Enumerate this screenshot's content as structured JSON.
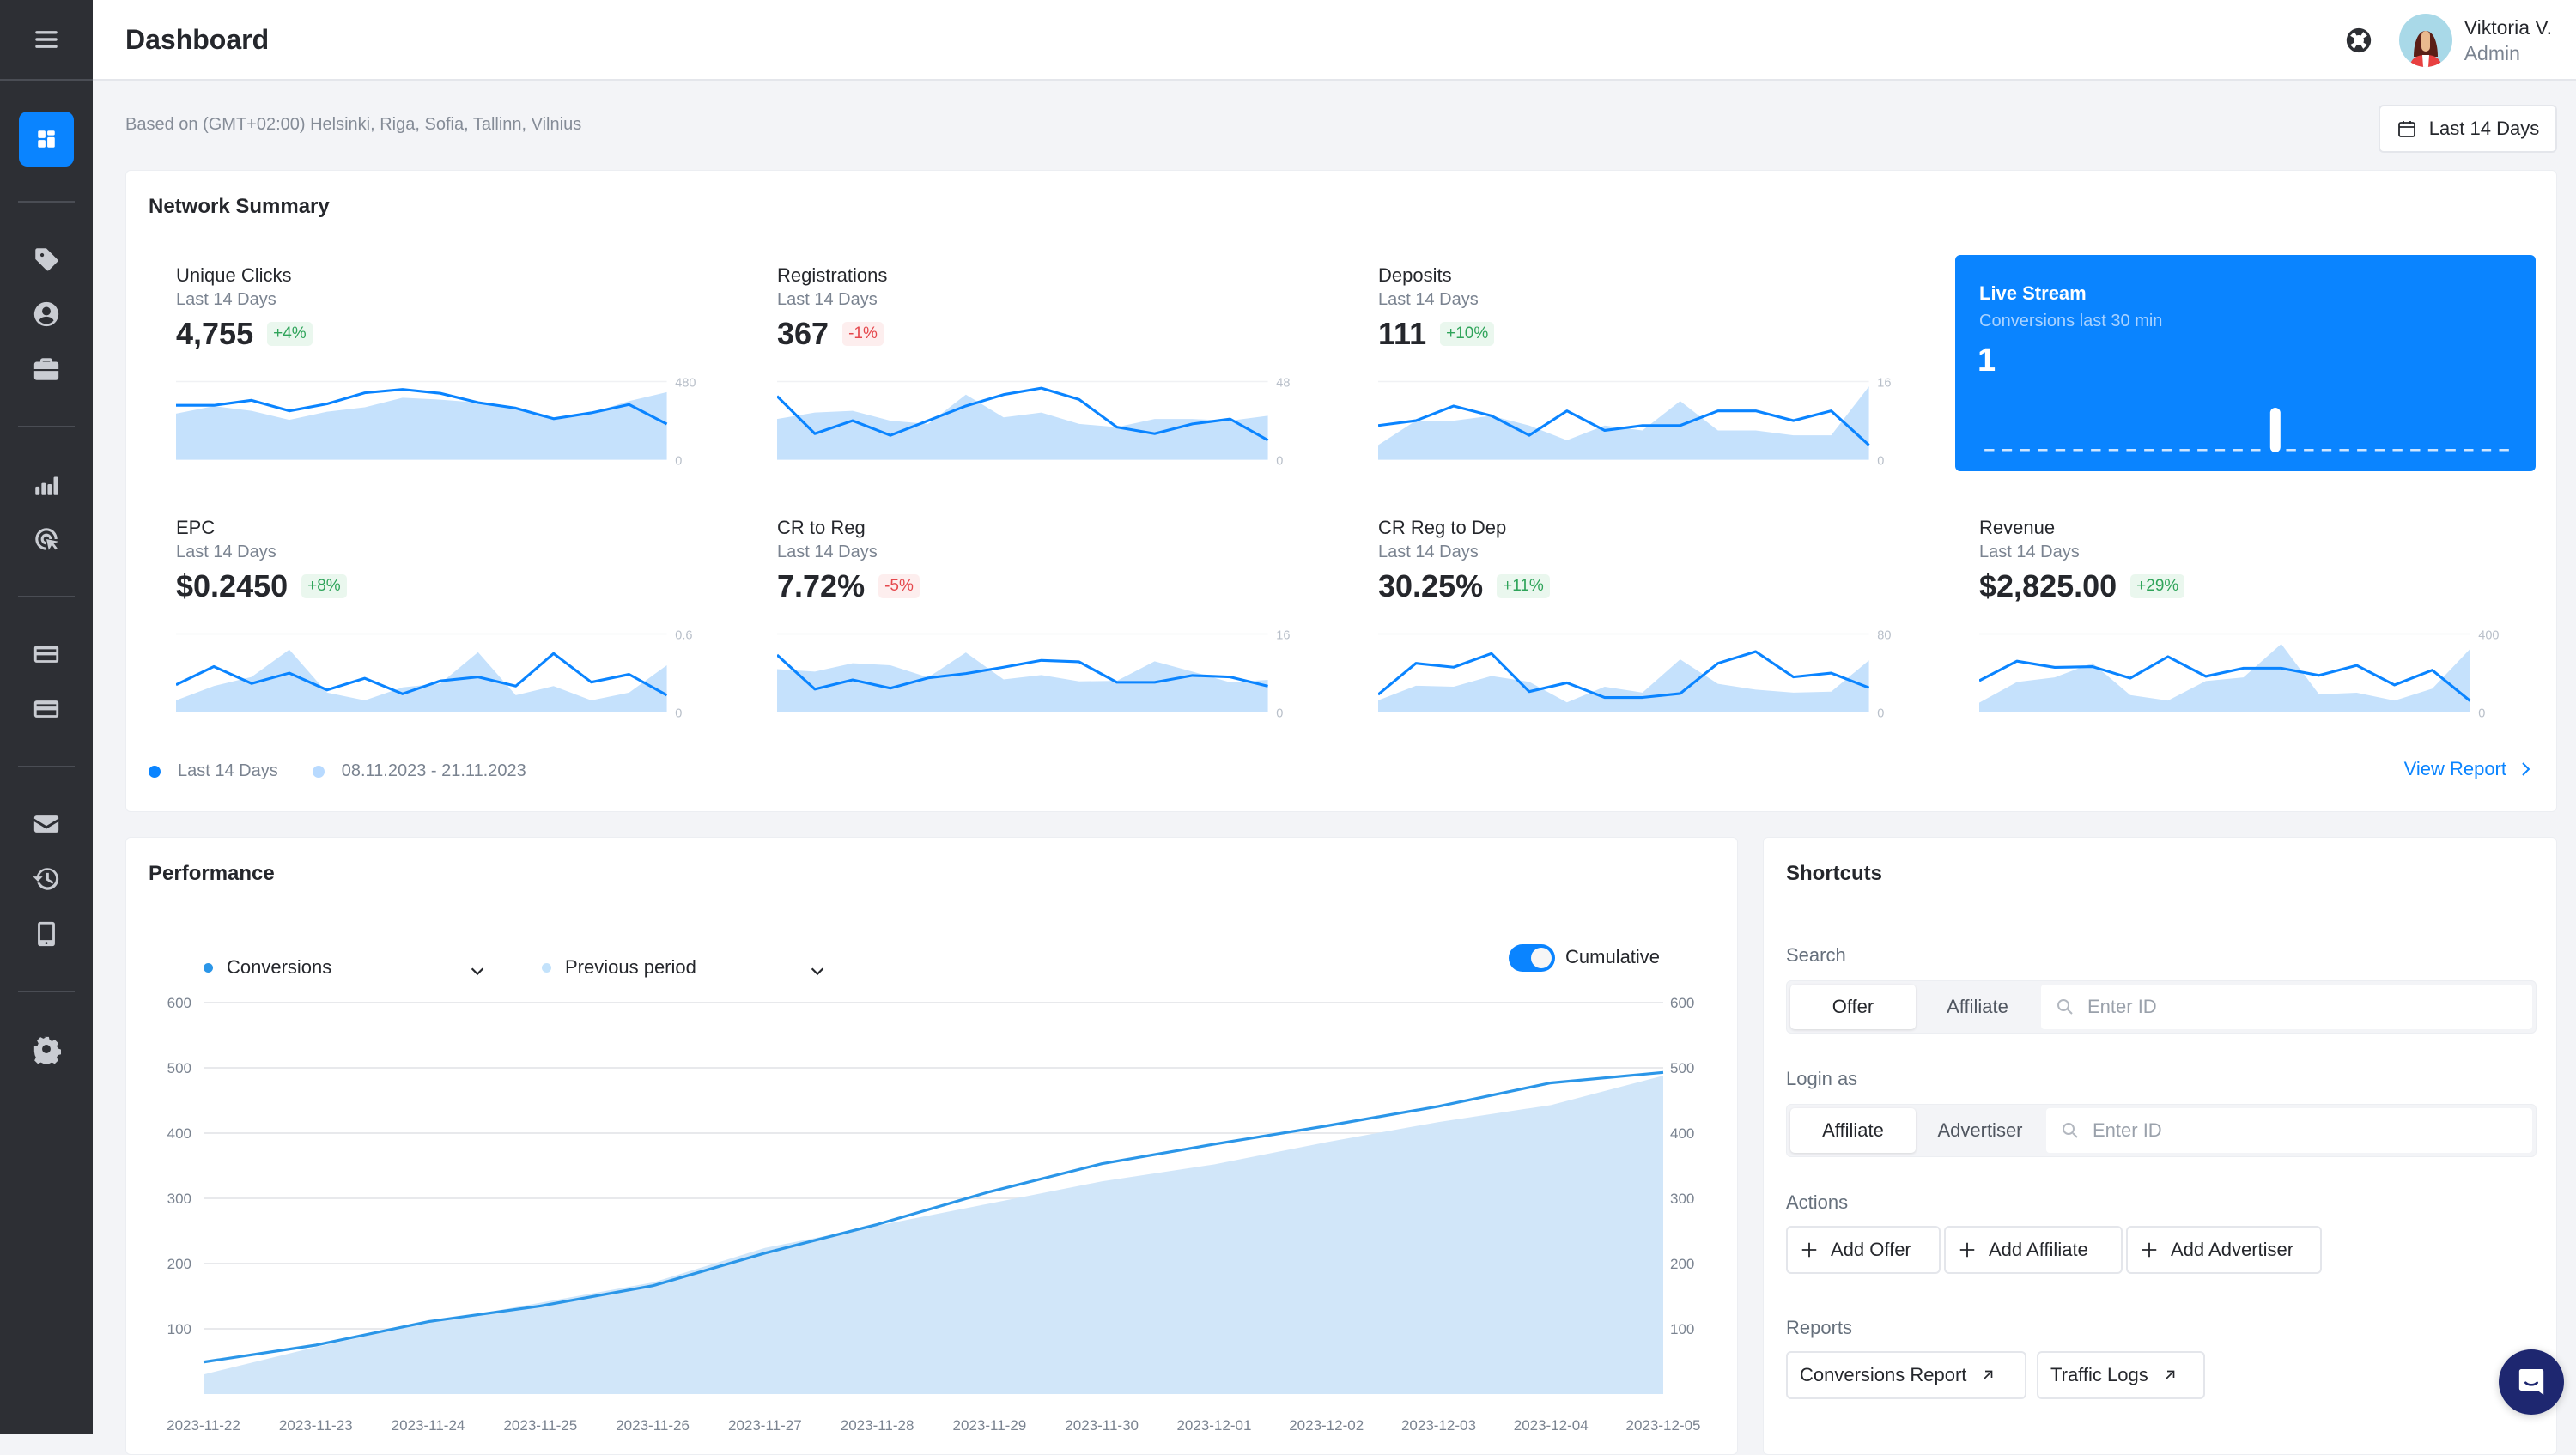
{
  "header": {
    "title": "Dashboard",
    "user_name": "Viktoria V.",
    "user_role": "Admin"
  },
  "sidebar": {
    "items": [
      {
        "name": "dashboard",
        "icon": "dashboard-icon",
        "active": true
      },
      {
        "name": "offers",
        "icon": "tag-icon"
      },
      {
        "name": "affiliates",
        "icon": "user-circle-icon"
      },
      {
        "name": "advertisers",
        "icon": "briefcase-icon"
      },
      {
        "name": "reports",
        "icon": "bar-chart-icon"
      },
      {
        "name": "tracking",
        "icon": "click-target-icon"
      },
      {
        "name": "billing",
        "icon": "credit-card-icon"
      },
      {
        "name": "payments",
        "icon": "credit-card-icon"
      },
      {
        "name": "messages",
        "icon": "mail-icon"
      },
      {
        "name": "history",
        "icon": "history-icon"
      },
      {
        "name": "mobile",
        "icon": "mobile-icon"
      },
      {
        "name": "settings",
        "icon": "gear-icon"
      }
    ]
  },
  "toolbar": {
    "timezone_note": "Based on (GMT+02:00) Helsinki, Riga, Sofia, Tallinn, Vilnius",
    "date_range_label": "Last 14 Days"
  },
  "network_summary": {
    "title": "Network Summary",
    "legend": {
      "current": "Last 14 Days",
      "previous": "08.11.2023 - 21.11.2023"
    },
    "view_report": "View Report",
    "live_stream": {
      "title": "Live Stream",
      "subtitle": "Conversions last 30 min",
      "value": "1",
      "bars": [
        0,
        0,
        0,
        0,
        0,
        0,
        0,
        0,
        0,
        0,
        0,
        0,
        0,
        0,
        0,
        0,
        1,
        0,
        0,
        0,
        0,
        0,
        0,
        0,
        0,
        0,
        0,
        0,
        0,
        0
      ]
    }
  },
  "colors": {
    "accent": "#0a84ff",
    "previous_fill": "#c5e1fc",
    "positive": "#2fa45a",
    "negative": "#e5484d",
    "sidebar_bg": "#2d2f34"
  },
  "chart_data": [
    {
      "type": "line",
      "title": "Unique Clicks",
      "subtitle": "Last 14 Days",
      "value": "4,755",
      "change": "+4%",
      "trend": "up",
      "ylim": [
        0,
        480
      ],
      "ytick_labels": [
        "480",
        "0"
      ],
      "series": [
        {
          "name": "Last 14 Days",
          "values": [
            334,
            334,
            365,
            300,
            343,
            411,
            432,
            408,
            351,
            317,
            252,
            288,
            339,
            219
          ]
        },
        {
          "name": "08.11.2023 - 21.11.2023",
          "values": [
            283,
            329,
            300,
            245,
            295,
            322,
            381,
            369,
            351,
            317,
            254,
            288,
            360,
            415
          ]
        }
      ]
    },
    {
      "type": "line",
      "title": "Registrations",
      "subtitle": "Last 14 Days",
      "value": "367",
      "change": "-1%",
      "trend": "down",
      "ylim": [
        0,
        48
      ],
      "ytick_labels": [
        "48",
        "0"
      ],
      "series": [
        {
          "name": "Last 14 Days",
          "values": [
            39,
            16,
            24,
            15,
            24,
            33,
            40,
            44,
            37,
            20,
            16,
            22,
            25,
            12
          ]
        },
        {
          "name": "08.11.2023 - 21.11.2023",
          "values": [
            25,
            29,
            30,
            24,
            22,
            40,
            26,
            29,
            22,
            20,
            25,
            25,
            24,
            27
          ]
        }
      ]
    },
    {
      "type": "line",
      "title": "Deposits",
      "subtitle": "Last 14 Days",
      "value": "111",
      "change": "+10%",
      "trend": "up",
      "ylim": [
        0,
        16
      ],
      "ytick_labels": [
        "16",
        "0"
      ],
      "series": [
        {
          "name": "Last 14 Days",
          "values": [
            7,
            8,
            11,
            9,
            5,
            10,
            6,
            7,
            7,
            10,
            10,
            8,
            10,
            3
          ]
        },
        {
          "name": "08.11.2023 - 21.11.2023",
          "values": [
            3,
            8,
            8,
            9,
            7,
            4,
            7,
            6,
            12,
            6,
            6,
            5,
            5,
            15
          ]
        }
      ]
    },
    {
      "type": "line",
      "title": "EPC",
      "subtitle": "Last 14 Days",
      "value": "$0.2450",
      "change": "+8%",
      "trend": "up",
      "ylim": [
        0,
        0.6
      ],
      "ytick_labels": [
        "0.6",
        "0"
      ],
      "series": [
        {
          "name": "Last 14 Days",
          "values": [
            0.21,
            0.35,
            0.22,
            0.3,
            0.17,
            0.26,
            0.14,
            0.24,
            0.27,
            0.2,
            0.45,
            0.23,
            0.29,
            0.13
          ]
        },
        {
          "name": "08.11.2023 - 21.11.2023",
          "values": [
            0.09,
            0.2,
            0.27,
            0.48,
            0.15,
            0.09,
            0.19,
            0.22,
            0.46,
            0.13,
            0.2,
            0.09,
            0.15,
            0.36
          ]
        }
      ]
    },
    {
      "type": "line",
      "title": "CR to Reg",
      "subtitle": "Last 14 Days",
      "value": "7.72%",
      "change": "-5%",
      "trend": "down",
      "ylim": [
        0,
        16
      ],
      "ytick_labels": [
        "16",
        "0"
      ],
      "series": [
        {
          "name": "Last 14 Days",
          "values": [
            11.7,
            4.7,
            6.6,
            4.9,
            7.0,
            7.9,
            9.2,
            10.6,
            10.3,
            6.1,
            6.1,
            7.5,
            7.2,
            5.3
          ]
        },
        {
          "name": "08.11.2023 - 21.11.2023",
          "values": [
            8.8,
            8.3,
            10.0,
            9.6,
            7.1,
            12.2,
            6.7,
            7.6,
            6.3,
            6.4,
            10.4,
            8.3,
            6.1,
            6.6
          ]
        }
      ]
    },
    {
      "type": "line",
      "title": "CR Reg to Dep",
      "subtitle": "Last 14 Days",
      "value": "30.25%",
      "change": "+11%",
      "trend": "up",
      "ylim": [
        0,
        80
      ],
      "ytick_labels": [
        "80",
        "0"
      ],
      "series": [
        {
          "name": "Last 14 Days",
          "values": [
            18,
            50,
            46,
            60,
            21,
            30,
            15,
            15,
            19,
            50,
            62,
            36,
            40,
            25
          ]
        },
        {
          "name": "08.11.2023 - 21.11.2023",
          "values": [
            12,
            27,
            26,
            37,
            31,
            10,
            26,
            20,
            54,
            29,
            23,
            20,
            21,
            53
          ]
        }
      ]
    },
    {
      "type": "line",
      "title": "Revenue",
      "subtitle": "Last 14 Days",
      "value": "$2,825.00",
      "change": "+29%",
      "trend": "up",
      "ylim": [
        0,
        400
      ],
      "ytick_labels": [
        "400",
        "0"
      ],
      "series": [
        {
          "name": "Last 14 Days",
          "values": [
            161,
            261,
            229,
            233,
            174,
            284,
            183,
            225,
            225,
            188,
            239,
            139,
            215,
            58
          ]
        },
        {
          "name": "08.11.2023 - 21.11.2023",
          "values": [
            48,
            154,
            178,
            251,
            87,
            59,
            159,
            178,
            349,
            91,
            99,
            59,
            120,
            323
          ]
        }
      ]
    },
    {
      "type": "area",
      "title": "Performance",
      "xlabel": "",
      "ylabel": "",
      "ylim": [
        0,
        600
      ],
      "yticks": [
        100,
        200,
        300,
        400,
        500,
        600
      ],
      "grid": true,
      "x": [
        "2023-11-22",
        "2023-11-23",
        "2023-11-24",
        "2023-11-25",
        "2023-11-26",
        "2023-11-27",
        "2023-11-28",
        "2023-11-29",
        "2023-11-30",
        "2023-12-01",
        "2023-12-02",
        "2023-12-03",
        "2023-12-04",
        "2023-12-05"
      ],
      "series": [
        {
          "name": "Conversions",
          "values": [
            49,
            75,
            111,
            135,
            166,
            216,
            260,
            310,
            353,
            383,
            411,
            441,
            477,
            493
          ]
        },
        {
          "name": "Previous period",
          "values": [
            30,
            72,
            109,
            140,
            171,
            224,
            258,
            292,
            326,
            352,
            386,
            417,
            443,
            488
          ]
        }
      ],
      "legend": "top-left",
      "cumulative_toggle": {
        "label": "Cumulative",
        "on": true
      }
    }
  ],
  "performance": {
    "title": "Performance",
    "metric_select": "Conversions",
    "compare_select": "Previous period",
    "cumulative_label": "Cumulative"
  },
  "shortcuts": {
    "title": "Shortcuts",
    "search": {
      "label": "Search",
      "options": [
        "Offer",
        "Affiliate"
      ],
      "selected": "Offer",
      "placeholder": "Enter ID"
    },
    "login_as": {
      "label": "Login as",
      "options": [
        "Affiliate",
        "Advertiser"
      ],
      "selected": "Affiliate",
      "placeholder": "Enter ID"
    },
    "actions": {
      "label": "Actions",
      "buttons": [
        "Add Offer",
        "Add Affiliate",
        "Add Advertiser"
      ]
    },
    "reports": {
      "label": "Reports",
      "links": [
        "Conversions Report",
        "Traffic Logs"
      ]
    }
  }
}
